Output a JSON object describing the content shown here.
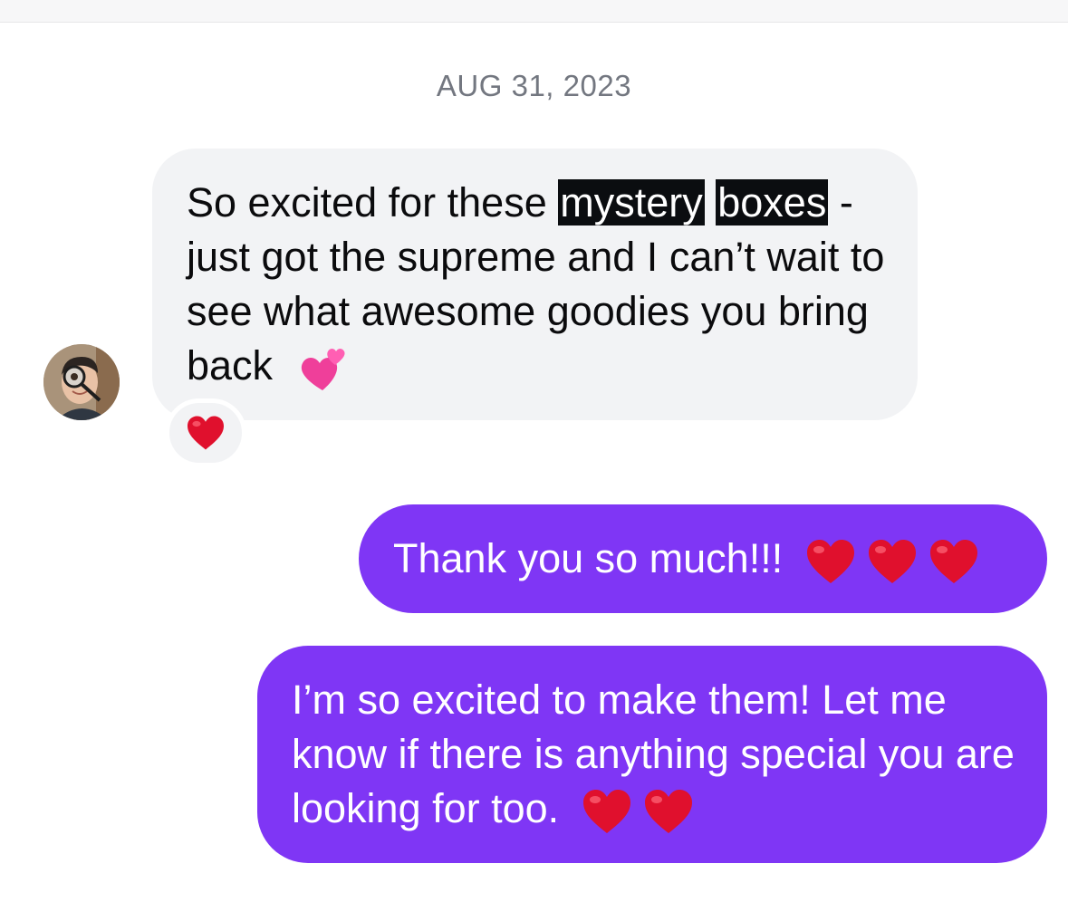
{
  "conversation": {
    "date_separator": "AUG 31, 2023",
    "incoming": {
      "avatar_icon": "user-avatar-icon",
      "text_before": "So excited for these ",
      "highlight_1": "mystery",
      "highlight_2": "boxes",
      "text_after": " - just got the supreme and I can’t wait to see what awesome goodies you bring back",
      "emoji": "two-hearts-icon",
      "reaction_emoji": "red-heart-icon"
    },
    "outgoing": [
      {
        "text": "Thank you so much!!!",
        "emoji_count": 3
      },
      {
        "text": "I’m so excited to make them! Let me know if there is anything special you are looking for too.",
        "emoji_count": 2
      }
    ],
    "colors": {
      "outgoing_bubble": "#7f36f5",
      "incoming_bubble": "#f2f3f5",
      "heart": "#e0102d",
      "date_text": "#737780"
    }
  }
}
